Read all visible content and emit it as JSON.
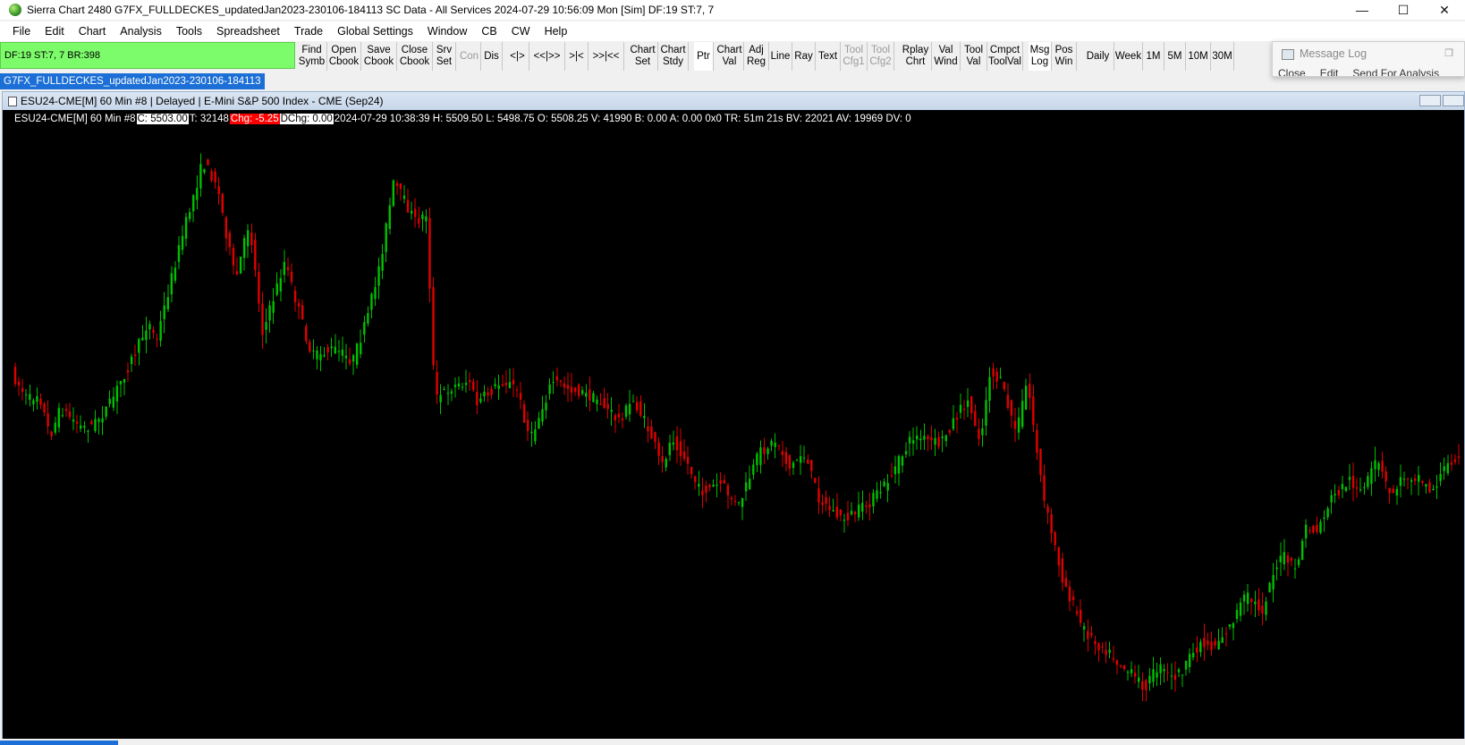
{
  "window": {
    "title": "Sierra Chart 2480 G7FX_FULLDECKES_updatedJan2023-230106-184113  SC Data - All Services 2024-07-29  10:56:09 Mon [Sim]  DF:19  ST:7, 7",
    "minimize_glyph": "—",
    "maximize_glyph": "☐",
    "close_glyph": "✕"
  },
  "menu": [
    "File",
    "Edit",
    "Chart",
    "Analysis",
    "Tools",
    "Spreadsheet",
    "Trade",
    "Global Settings",
    "Window",
    "CB",
    "CW",
    "Help"
  ],
  "status_box": "DF:19  ST:7, 7  BR:398",
  "toolbar": [
    {
      "l1": "Find",
      "l2": "Symb"
    },
    {
      "l1": "Open",
      "l2": "Cbook"
    },
    {
      "l1": "Save",
      "l2": "Cbook"
    },
    {
      "l1": "Close",
      "l2": "Cbook"
    },
    {
      "l1": "Srv",
      "l2": "Set"
    },
    {
      "l1": "Con",
      "l2": "",
      "disabled": true
    },
    {
      "l1": "Dis",
      "l2": ""
    },
    {
      "l1": "<|>",
      "l2": ""
    },
    {
      "l1": "<<|>>",
      "l2": ""
    },
    {
      "l1": ">|<",
      "l2": ""
    },
    {
      "l1": ">>|<<",
      "l2": ""
    },
    {
      "l1": "Chart",
      "l2": "Set"
    },
    {
      "l1": "Chart",
      "l2": "Stdy"
    },
    {
      "l1": "Ptr",
      "l2": "",
      "active": true
    },
    {
      "l1": "Chart",
      "l2": "Val"
    },
    {
      "l1": "Adj",
      "l2": "Reg"
    },
    {
      "l1": "Line",
      "l2": ""
    },
    {
      "l1": "Ray",
      "l2": ""
    },
    {
      "l1": "Text",
      "l2": ""
    },
    {
      "l1": "Tool",
      "l2": "Cfg1",
      "disabled": true
    },
    {
      "l1": "Tool",
      "l2": "Cfg2",
      "disabled": true
    },
    {
      "l1": "Rplay",
      "l2": "Chrt"
    },
    {
      "l1": "Val",
      "l2": "Wind"
    },
    {
      "l1": "Tool",
      "l2": "Val"
    },
    {
      "l1": "Cmpct",
      "l2": "ToolVal"
    },
    {
      "l1": "Msg",
      "l2": "Log",
      "active": true
    },
    {
      "l1": "Pos",
      "l2": "Win"
    },
    {
      "l1": "Daily",
      "l2": ""
    },
    {
      "l1": "Week",
      "l2": ""
    },
    {
      "l1": "1M",
      "l2": ""
    },
    {
      "l1": "5M",
      "l2": ""
    },
    {
      "l1": "10M",
      "l2": ""
    },
    {
      "l1": "30M",
      "l2": ""
    }
  ],
  "chartbook_tab": "G7FX_FULLDECKES_updatedJan2023-230106-184113",
  "message_log": {
    "title": "Message Log",
    "menu": [
      "Close",
      "Edit",
      "Send For Analysis"
    ]
  },
  "chart_window": {
    "title": "ESU24-CME[M]  60 Min   #8 | Delayed | E-Mini S&P 500 Index - CME (Sep24)",
    "info": {
      "symbol": "ESU24-CME[M]  60 Min   #8",
      "close": "C: 5503.00",
      "trades": "T: 32148",
      "chg": "Chg: -5.25",
      "dchg": "DChg: 0.00",
      "rest": "2024-07-29 10:38:39 H: 5509.50  L: 5498.75  O: 5508.25  V: 41990  B: 0.00  A: 0.00  0x0  TR: 51m 21s  BV: 22021  AV: 19969  DV: 0"
    },
    "colors": {
      "up": "#00c000",
      "down": "#e00000",
      "background": "#000000"
    }
  },
  "chart_data": {
    "type": "candlestick",
    "title": "ESU24-CME[M] 60 Min",
    "path": [
      [
        0,
        18
      ],
      [
        6,
        25
      ],
      [
        10,
        23
      ],
      [
        14,
        34
      ],
      [
        18,
        27
      ],
      [
        26,
        32
      ],
      [
        30,
        31
      ],
      [
        36,
        26
      ],
      [
        40,
        20
      ],
      [
        46,
        12
      ],
      [
        50,
        5
      ],
      [
        53,
        10
      ],
      [
        60,
        -10
      ],
      [
        70,
        -35
      ],
      [
        75,
        -30
      ],
      [
        82,
        -5
      ],
      [
        87,
        -20
      ],
      [
        92,
        8
      ],
      [
        100,
        -10
      ],
      [
        110,
        14
      ],
      [
        118,
        12
      ],
      [
        125,
        15
      ],
      [
        130,
        5
      ],
      [
        135,
        -10
      ],
      [
        140,
        -30
      ],
      [
        148,
        -20
      ],
      [
        152,
        -22
      ],
      [
        155,
        25
      ],
      [
        160,
        22
      ],
      [
        168,
        20
      ],
      [
        170,
        26
      ],
      [
        180,
        20
      ],
      [
        185,
        22
      ],
      [
        190,
        35
      ],
      [
        198,
        20
      ],
      [
        205,
        22
      ],
      [
        215,
        25
      ],
      [
        222,
        30
      ],
      [
        228,
        25
      ],
      [
        235,
        35
      ],
      [
        238,
        42
      ],
      [
        242,
        34
      ],
      [
        247,
        40
      ],
      [
        252,
        48
      ],
      [
        260,
        46
      ],
      [
        266,
        52
      ],
      [
        270,
        45
      ],
      [
        274,
        38
      ],
      [
        280,
        35
      ],
      [
        285,
        42
      ],
      [
        290,
        38
      ],
      [
        296,
        50
      ],
      [
        304,
        55
      ],
      [
        312,
        52
      ],
      [
        318,
        48
      ],
      [
        322,
        44
      ],
      [
        330,
        34
      ],
      [
        340,
        36
      ],
      [
        345,
        30
      ],
      [
        350,
        25
      ],
      [
        355,
        35
      ],
      [
        358,
        18
      ],
      [
        362,
        20
      ],
      [
        368,
        33
      ],
      [
        372,
        20
      ],
      [
        378,
        50
      ],
      [
        385,
        70
      ],
      [
        392,
        82
      ],
      [
        397,
        86
      ],
      [
        400,
        87
      ],
      [
        404,
        90
      ],
      [
        410,
        94
      ],
      [
        415,
        97
      ],
      [
        420,
        92
      ],
      [
        425,
        95
      ],
      [
        430,
        92
      ],
      [
        435,
        86
      ],
      [
        440,
        87
      ],
      [
        446,
        82
      ],
      [
        452,
        74
      ],
      [
        458,
        78
      ],
      [
        462,
        68
      ],
      [
        466,
        64
      ],
      [
        470,
        68
      ],
      [
        474,
        57
      ],
      [
        478,
        58
      ],
      [
        483,
        50
      ],
      [
        490,
        45
      ],
      [
        495,
        48
      ],
      [
        500,
        40
      ],
      [
        505,
        49
      ],
      [
        510,
        44
      ],
      [
        515,
        44
      ],
      [
        520,
        48
      ],
      [
        525,
        42
      ],
      [
        530,
        38
      ]
    ],
    "n_bars": 398,
    "colors": {
      "up": "#00c000",
      "down": "#e00000"
    }
  }
}
